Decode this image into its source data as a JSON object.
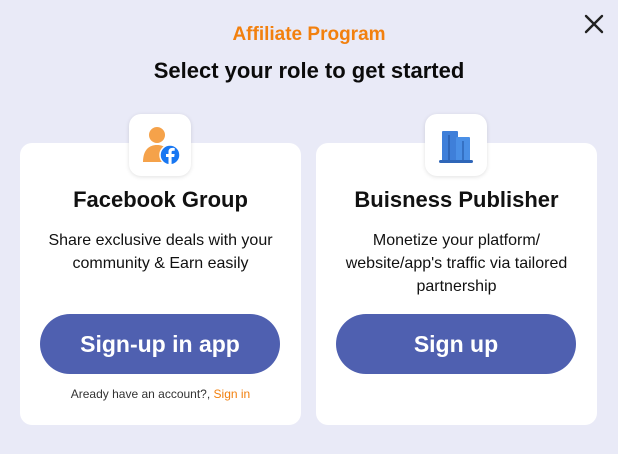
{
  "header": {
    "kicker": "Affiliate Program",
    "headline": "Select your role to get started"
  },
  "cards": [
    {
      "icon": "facebook-group-icon",
      "title": "Facebook Group",
      "description": "Share exclusive deals with your community & Earn easily",
      "cta_label": "Sign-up in app",
      "signin_prompt": "Aready have an account?,",
      "signin_link": "Sign in"
    },
    {
      "icon": "building-icon",
      "title": "Buisness Publisher",
      "description": "Monetize your platform/ website/app's traffic via tailored partnership",
      "cta_label": "Sign up"
    }
  ],
  "colors": {
    "background": "#E9EAF7",
    "accent_orange": "#F2800E",
    "button_blue": "#4F60B0",
    "card": "#FFFFFF"
  }
}
